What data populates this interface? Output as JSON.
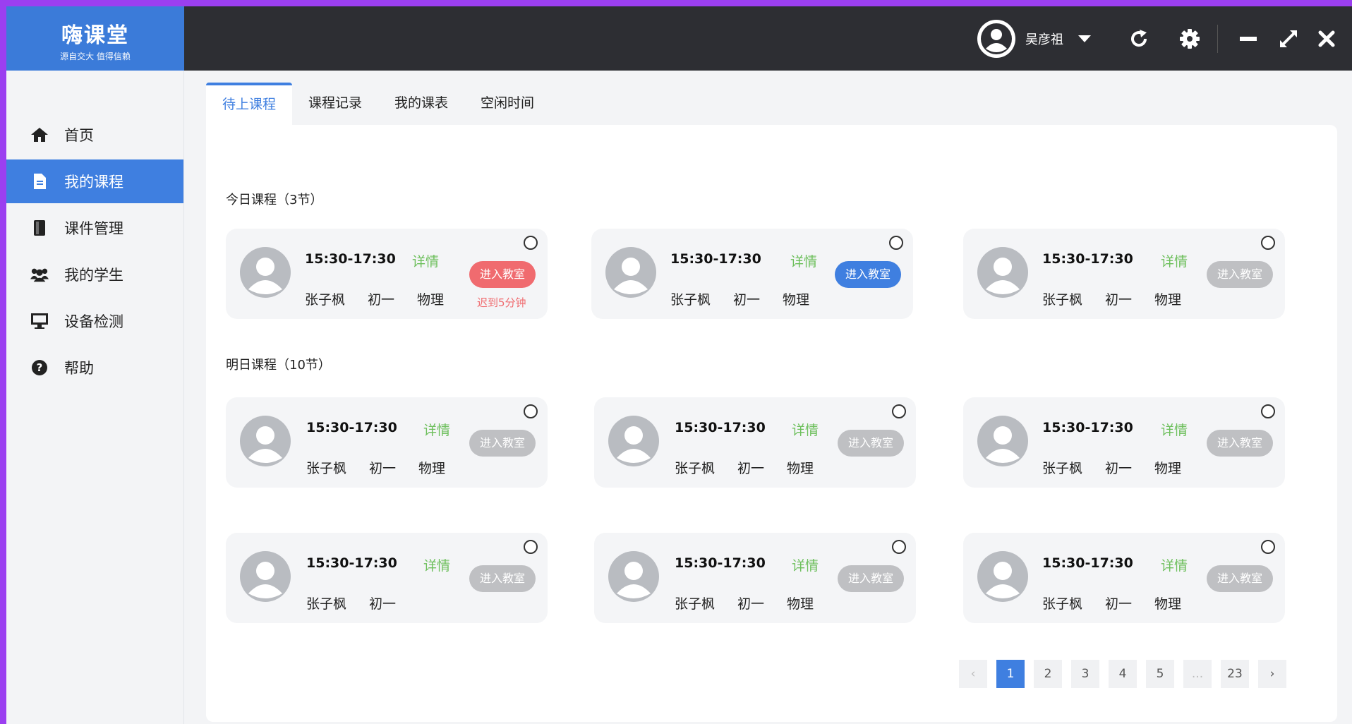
{
  "app": {
    "logo_name": "嗨课堂",
    "logo_slogan": "源自交大 值得信赖",
    "user_name": "吴彦祖"
  },
  "sidebar": {
    "items": [
      {
        "label": "首页",
        "icon": "home-icon"
      },
      {
        "label": "我的课程",
        "icon": "document-icon"
      },
      {
        "label": "课件管理",
        "icon": "book-icon"
      },
      {
        "label": "我的学生",
        "icon": "users-icon"
      },
      {
        "label": "设备检测",
        "icon": "monitor-icon"
      },
      {
        "label": "帮助",
        "icon": "question-icon"
      }
    ]
  },
  "tabs": [
    "待上课程",
    "课程记录",
    "我的课表",
    "空闲时间"
  ],
  "today": {
    "title": "今日课程（3节）",
    "cards": [
      {
        "time": "15:30-17:30",
        "detail": "详情",
        "name": "张子枫",
        "grade": "初一",
        "subject": "物理",
        "enter": "进入教室",
        "enter_state": "late",
        "late_text": "迟到5分钟"
      },
      {
        "time": "15:30-17:30",
        "detail": "详情",
        "name": "张子枫",
        "grade": "初一",
        "subject": "物理",
        "enter": "进入教室",
        "enter_state": "active"
      },
      {
        "time": "15:30-17:30",
        "detail": "详情",
        "name": "张子枫",
        "grade": "初一",
        "subject": "物理",
        "enter": "进入教室",
        "enter_state": "disabled"
      }
    ]
  },
  "tomorrow": {
    "title": "明日课程（10节）",
    "cards": [
      {
        "time": "15:30-17:30",
        "detail": "详情",
        "name": "张子枫",
        "grade": "初一",
        "subject": "物理",
        "enter": "进入教室"
      },
      {
        "time": "15:30-17:30",
        "detail": "详情",
        "name": "张子枫",
        "grade": "初一",
        "subject": "物理",
        "enter": "进入教室"
      },
      {
        "time": "15:30-17:30",
        "detail": "详情",
        "name": "张子枫",
        "grade": "初一",
        "subject": "物理",
        "enter": "进入教室"
      },
      {
        "time": "15:30-17:30",
        "detail": "详情",
        "name": "张子枫",
        "grade": "初一",
        "subject": "",
        "enter": "进入教室"
      },
      {
        "time": "15:30-17:30",
        "detail": "详情",
        "name": "张子枫",
        "grade": "初一",
        "subject": "物理",
        "enter": "进入教室"
      },
      {
        "time": "15:30-17:30",
        "detail": "详情",
        "name": "张子枫",
        "grade": "初一",
        "subject": "物理",
        "enter": "进入教室"
      }
    ]
  },
  "pagination": {
    "prev": "‹",
    "pages": [
      "1",
      "2",
      "3",
      "4",
      "5",
      "...",
      "23"
    ],
    "current": "1",
    "next": "›"
  },
  "colors": {
    "brand_blue": "#3f7fe0",
    "header_dark": "#2d2e33",
    "late_red": "#f06b6f",
    "detail_green": "#6cbf5b",
    "outer_purple": "#9b3ff0"
  }
}
